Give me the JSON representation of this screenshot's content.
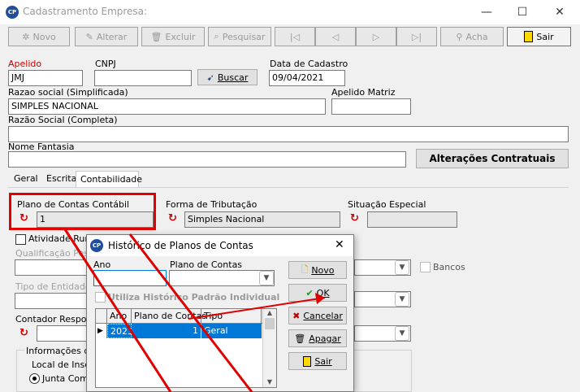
{
  "window": {
    "title": "Cadastramento Empresa:",
    "minimize": "—",
    "maximize": "☐",
    "close": "✕"
  },
  "toolbar": {
    "novo": "Novo",
    "alterar": "Alterar",
    "excluir": "Excluir",
    "pesquisar": "Pesquisar",
    "first": "|◁",
    "prev": "◁",
    "next": "▷",
    "last": "▷|",
    "acha": "Acha",
    "sair": "Sair"
  },
  "form": {
    "apelido_label": "Apelido",
    "apelido_value": "JMJ",
    "cnpj_label": "CNPJ",
    "cnpj_value": "",
    "buscar_label": "Buscar",
    "data_cadastro_label": "Data de Cadastro",
    "data_cadastro_value": "09/04/2021",
    "razao_simplificada_label": "Razao social (Simplificada)",
    "razao_simplificada_value": "SIMPLES NACIONAL",
    "apelido_matriz_label": "Apelido Matriz",
    "apelido_matriz_value": "",
    "razao_completa_label": "Razão Social (Completa)",
    "razao_completa_value": "",
    "nome_fantasia_label": "Nome Fantasia",
    "nome_fantasia_value": "",
    "alteracoes_label": "Alterações Contratuais"
  },
  "tabs": [
    {
      "label": "Geral"
    },
    {
      "label": "Escrita"
    },
    {
      "label": "Contabilidade"
    }
  ],
  "contab": {
    "plano_label": "Plano de Contas Contábil",
    "plano_value": "1",
    "forma_label": "Forma de Tributação",
    "forma_value": "Simples Nacional",
    "situacao_label": "Situação Especial",
    "situacao_value": "",
    "atividade_label": "Atividade Rural",
    "qualificacao_label": "Qualificação Pesso",
    "tipo_entidade_label": "Tipo de Entidade",
    "contador_label": "Contador Respons",
    "informacoes_label": "Informações de",
    "local_label": "Local de Inscr",
    "junta_label": "Junta Come",
    "bancos_label": "Bancos"
  },
  "dialog": {
    "title": "Histórico de Planos de Contas",
    "close": "✕",
    "ano_label": "Ano",
    "ano_value": "",
    "plano_label": "Plano de Contas",
    "plano_value": "",
    "utiliza_label": "Utiliza Histórico Padrão Individual",
    "columns": [
      "Ano",
      "Plano de Contas",
      "Tipo"
    ],
    "rows": [
      {
        "ano": "2023",
        "plano": "1",
        "tipo": "Geral"
      }
    ],
    "novo": "Novo",
    "ok": "OK",
    "cancelar": "Cancelar",
    "apagar": "Apagar",
    "sair": "Sair"
  },
  "colors": {
    "annotation_red": "#e00000",
    "selection_blue": "#0078d7",
    "refresh_red": "#d00000"
  }
}
